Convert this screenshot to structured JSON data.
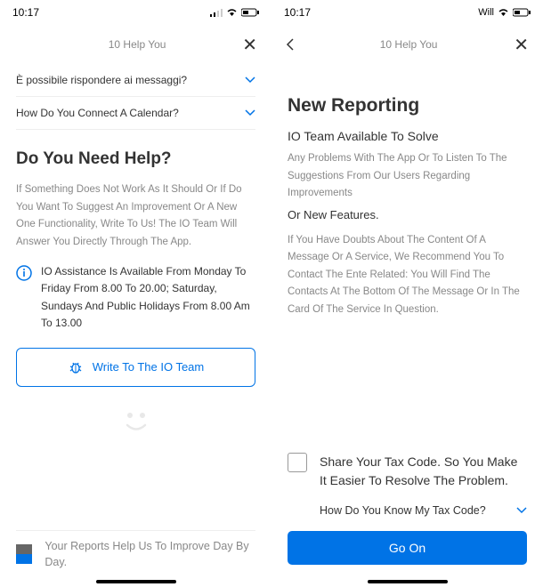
{
  "left": {
    "status": {
      "time": "10:17"
    },
    "header": {
      "title": "10 Help You"
    },
    "faq1": "È possibile rispondere ai messaggi?",
    "faq2": "How Do You Connect A Calendar?",
    "section_title": "Do You Need Help?",
    "body": "If Something Does Not Work As It Should Or If Do You Want To Suggest An Improvement Or A New One Functionality, Write To Us! The IO Team Will Answer You Directly Through The App.",
    "info": "IO Assistance Is Available From Monday To Friday From 8.00 To 20.00; Saturday, Sundays And Public Holidays From 8.00 Am To 13.00",
    "write_btn": "Write To The IO Team",
    "banner": "Your Reports Help Us To Improve Day By Day."
  },
  "right": {
    "status": {
      "time": "10:17",
      "carrier": "Will"
    },
    "header": {
      "title": "10 Help You"
    },
    "title": "New Reporting",
    "sub": "IO Team Available To Solve",
    "p1": "Any Problems With The App Or To Listen To The Suggestions From Our Users Regarding Improvements",
    "p1b": "Or New Features.",
    "p2": "If You Have Doubts About The Content Of A Message Or A Service, We Recommend You To Contact The Ente Related: You Will Find The Contacts At The Bottom Of The Message Or In The Card Of The Service In Question.",
    "checkbox_text": "Share Your Tax Code. So You Make It Easier To Resolve The Problem.",
    "tax_code": "How Do You Know My Tax Code?",
    "go_btn": "Go On"
  }
}
